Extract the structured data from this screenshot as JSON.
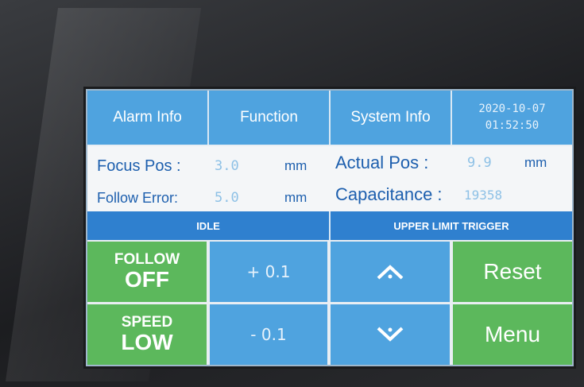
{
  "tabs": {
    "alarm_info": "Alarm Info",
    "function": "Function",
    "system_info": "System Info",
    "date": "2020-10-07",
    "time": "01:52:50"
  },
  "info": {
    "focus_pos": {
      "label": "Focus Pos :",
      "value": "3.0",
      "unit": "mm"
    },
    "actual_pos": {
      "label": "Actual Pos :",
      "value": "9.9",
      "unit": "mm"
    },
    "follow_error": {
      "label": "Follow Error:",
      "value": "5.0",
      "unit": "mm"
    },
    "capacitance": {
      "label": "Capacitance :",
      "value": "19358"
    }
  },
  "status": {
    "left": "IDLE",
    "right": "UPPER LIMIT TRIGGER"
  },
  "controls": {
    "follow_label": "FOLLOW",
    "follow_state": "OFF",
    "speed_label": "SPEED",
    "speed_state": "LOW",
    "plus_step": "+ 0.1",
    "minus_step": "- 0.1",
    "up_icon": "chevron-up-icon",
    "down_icon": "chevron-down-icon",
    "reset": "Reset",
    "menu": "Menu"
  },
  "colors": {
    "tab_blue": "#4fa3df",
    "status_blue": "#2f80cf",
    "button_green": "#5cb85c",
    "label_blue": "#1d5fae"
  }
}
